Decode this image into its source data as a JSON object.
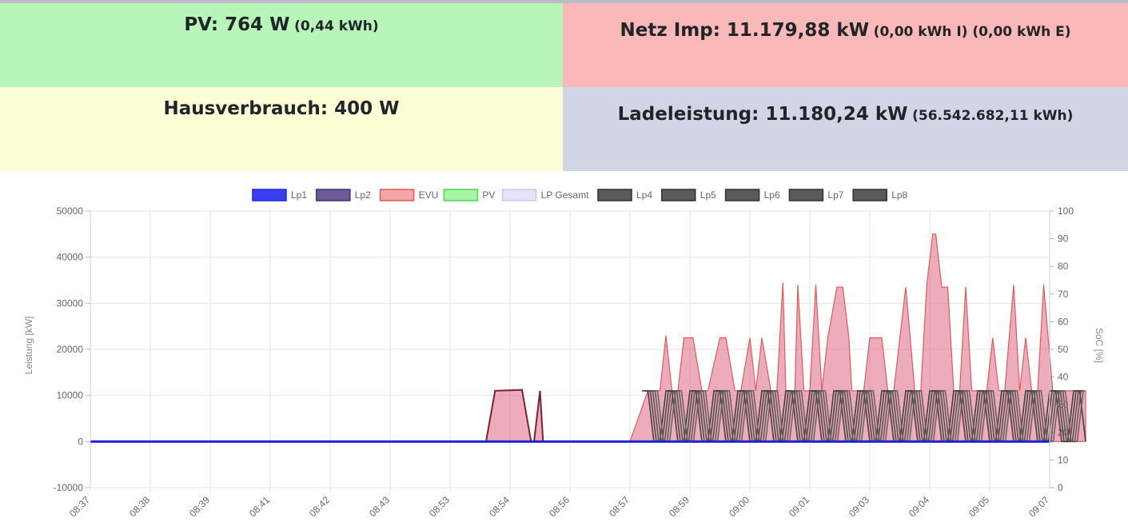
{
  "tiles": {
    "pv": {
      "label": "PV: 764 W",
      "detail": "(0,44 kWh)"
    },
    "grid": {
      "label": "Netz Imp: 11.179,88 kW",
      "detail": "(0,00 kWh I) (0,00 kWh E)"
    },
    "house": {
      "label": "Hausverbrauch: 400 W",
      "detail": ""
    },
    "charge": {
      "label": "Ladeleistung: 11.180,24 kW",
      "detail": "(56.542.682,11 kWh)"
    }
  },
  "colors": {
    "pv_tile": "#b8f5b8",
    "grid_tile": "#fbb8b8",
    "house_tile": "#fdfed6",
    "charge_tile": "#d2d5e5"
  },
  "chart_data": {
    "type": "area",
    "xlabel": "",
    "ylabel": "Leistung [kW]",
    "y2label": "SoC [%]",
    "ylim": [
      -10000,
      50000
    ],
    "y2lim": [
      0,
      100
    ],
    "yticks": [
      "50000",
      "40000",
      "30000",
      "20000",
      "10000",
      "0",
      "-10000"
    ],
    "y2ticks": [
      "100",
      "90",
      "80",
      "70",
      "60",
      "50",
      "40",
      "30",
      "20",
      "10",
      "0"
    ],
    "grid": true,
    "legend_position": "top",
    "legend": [
      {
        "name": "Lp1",
        "fill": "#3b3ef0",
        "stroke": "#1f22d8"
      },
      {
        "name": "Lp2",
        "fill": "#6b5a96",
        "stroke": "#3e2f6e"
      },
      {
        "name": "EVU",
        "fill": "#f4a6a6",
        "stroke": "#e05a5a"
      },
      {
        "name": "PV",
        "fill": "#a8f5a8",
        "stroke": "#4ad84a"
      },
      {
        "name": "LP Gesamt",
        "fill": "#e4e4f8",
        "stroke": "#c8c8ee"
      },
      {
        "name": "Lp4",
        "fill": "#5a5a5a",
        "stroke": "#303030"
      },
      {
        "name": "Lp5",
        "fill": "#5a5a5a",
        "stroke": "#303030"
      },
      {
        "name": "Lp6",
        "fill": "#5a5a5a",
        "stroke": "#303030"
      },
      {
        "name": "Lp7",
        "fill": "#5a5a5a",
        "stroke": "#303030"
      },
      {
        "name": "Lp8",
        "fill": "#5a5a5a",
        "stroke": "#303030"
      }
    ],
    "x_labels": [
      "08:37",
      "08:38",
      "08:39",
      "08:41",
      "08:42",
      "08:43",
      "08:53",
      "08:54",
      "08:56",
      "08:57",
      "08:59",
      "09:00",
      "09:01",
      "09:03",
      "09:04",
      "09:05",
      "09:07"
    ],
    "evu_series": {
      "name": "EVU",
      "x": [
        0,
        6.6,
        6.75,
        7.2,
        7.35,
        7.4,
        7.5,
        7.55,
        7.65,
        8.5,
        9.0,
        9.3,
        9.4,
        9.5,
        9.6,
        9.7,
        9.8,
        9.9,
        10.05,
        10.2,
        10.3,
        10.5,
        10.6,
        10.75,
        10.85,
        11.0,
        11.1,
        11.2,
        11.35,
        11.45,
        11.55,
        11.6,
        11.75,
        11.8,
        11.9,
        12.0,
        12.1,
        12.2,
        12.3,
        12.45,
        12.55,
        12.65,
        12.7,
        12.9,
        13.0,
        13.1,
        13.2,
        13.3,
        13.4,
        13.6,
        13.75,
        13.85,
        13.95,
        14.05,
        14.1,
        14.2,
        14.3,
        14.4,
        14.5,
        14.6,
        14.7,
        14.85,
        14.95,
        15.05,
        15.15,
        15.25,
        15.4,
        15.5,
        15.6,
        15.7,
        15.8,
        15.9,
        16.05,
        16.15,
        16.25,
        16.35,
        16.45,
        16.6
      ],
      "y": [
        0,
        0,
        11000,
        11200,
        0,
        0,
        11000,
        0,
        0,
        0,
        0,
        11000,
        11000,
        11000,
        23000,
        11000,
        11000,
        22500,
        22500,
        11000,
        11000,
        22500,
        22500,
        11000,
        11000,
        22500,
        11000,
        22500,
        11000,
        11000,
        34500,
        11000,
        11000,
        34000,
        11000,
        11000,
        34000,
        11000,
        22500,
        33500,
        33500,
        22500,
        11000,
        11000,
        22500,
        22500,
        22500,
        11000,
        11000,
        33500,
        11000,
        11000,
        34000,
        45000,
        45000,
        33500,
        33500,
        11000,
        11000,
        33500,
        11000,
        11000,
        11000,
        22500,
        11000,
        11000,
        34000,
        11000,
        22500,
        11000,
        11000,
        34000,
        11000,
        11000,
        11000,
        11000,
        11000,
        11000
      ]
    },
    "lp_oscillation": {
      "name": "Lp4-Lp8",
      "start": 9.2,
      "end": 16.6,
      "step": 0.2,
      "high": 11000,
      "low": 0
    },
    "lp1_series": {
      "name": "Lp1",
      "constant": 0
    }
  }
}
